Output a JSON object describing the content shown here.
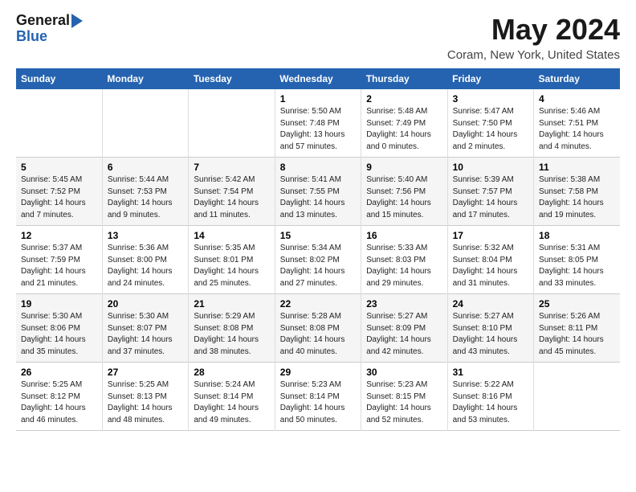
{
  "header": {
    "logo_general": "General",
    "logo_blue": "Blue",
    "title": "May 2024",
    "subtitle": "Coram, New York, United States"
  },
  "weekdays": [
    "Sunday",
    "Monday",
    "Tuesday",
    "Wednesday",
    "Thursday",
    "Friday",
    "Saturday"
  ],
  "weeks": [
    [
      {
        "day": "",
        "info": ""
      },
      {
        "day": "",
        "info": ""
      },
      {
        "day": "",
        "info": ""
      },
      {
        "day": "1",
        "info": "Sunrise: 5:50 AM\nSunset: 7:48 PM\nDaylight: 13 hours\nand 57 minutes."
      },
      {
        "day": "2",
        "info": "Sunrise: 5:48 AM\nSunset: 7:49 PM\nDaylight: 14 hours\nand 0 minutes."
      },
      {
        "day": "3",
        "info": "Sunrise: 5:47 AM\nSunset: 7:50 PM\nDaylight: 14 hours\nand 2 minutes."
      },
      {
        "day": "4",
        "info": "Sunrise: 5:46 AM\nSunset: 7:51 PM\nDaylight: 14 hours\nand 4 minutes."
      }
    ],
    [
      {
        "day": "5",
        "info": "Sunrise: 5:45 AM\nSunset: 7:52 PM\nDaylight: 14 hours\nand 7 minutes."
      },
      {
        "day": "6",
        "info": "Sunrise: 5:44 AM\nSunset: 7:53 PM\nDaylight: 14 hours\nand 9 minutes."
      },
      {
        "day": "7",
        "info": "Sunrise: 5:42 AM\nSunset: 7:54 PM\nDaylight: 14 hours\nand 11 minutes."
      },
      {
        "day": "8",
        "info": "Sunrise: 5:41 AM\nSunset: 7:55 PM\nDaylight: 14 hours\nand 13 minutes."
      },
      {
        "day": "9",
        "info": "Sunrise: 5:40 AM\nSunset: 7:56 PM\nDaylight: 14 hours\nand 15 minutes."
      },
      {
        "day": "10",
        "info": "Sunrise: 5:39 AM\nSunset: 7:57 PM\nDaylight: 14 hours\nand 17 minutes."
      },
      {
        "day": "11",
        "info": "Sunrise: 5:38 AM\nSunset: 7:58 PM\nDaylight: 14 hours\nand 19 minutes."
      }
    ],
    [
      {
        "day": "12",
        "info": "Sunrise: 5:37 AM\nSunset: 7:59 PM\nDaylight: 14 hours\nand 21 minutes."
      },
      {
        "day": "13",
        "info": "Sunrise: 5:36 AM\nSunset: 8:00 PM\nDaylight: 14 hours\nand 24 minutes."
      },
      {
        "day": "14",
        "info": "Sunrise: 5:35 AM\nSunset: 8:01 PM\nDaylight: 14 hours\nand 25 minutes."
      },
      {
        "day": "15",
        "info": "Sunrise: 5:34 AM\nSunset: 8:02 PM\nDaylight: 14 hours\nand 27 minutes."
      },
      {
        "day": "16",
        "info": "Sunrise: 5:33 AM\nSunset: 8:03 PM\nDaylight: 14 hours\nand 29 minutes."
      },
      {
        "day": "17",
        "info": "Sunrise: 5:32 AM\nSunset: 8:04 PM\nDaylight: 14 hours\nand 31 minutes."
      },
      {
        "day": "18",
        "info": "Sunrise: 5:31 AM\nSunset: 8:05 PM\nDaylight: 14 hours\nand 33 minutes."
      }
    ],
    [
      {
        "day": "19",
        "info": "Sunrise: 5:30 AM\nSunset: 8:06 PM\nDaylight: 14 hours\nand 35 minutes."
      },
      {
        "day": "20",
        "info": "Sunrise: 5:30 AM\nSunset: 8:07 PM\nDaylight: 14 hours\nand 37 minutes."
      },
      {
        "day": "21",
        "info": "Sunrise: 5:29 AM\nSunset: 8:08 PM\nDaylight: 14 hours\nand 38 minutes."
      },
      {
        "day": "22",
        "info": "Sunrise: 5:28 AM\nSunset: 8:08 PM\nDaylight: 14 hours\nand 40 minutes."
      },
      {
        "day": "23",
        "info": "Sunrise: 5:27 AM\nSunset: 8:09 PM\nDaylight: 14 hours\nand 42 minutes."
      },
      {
        "day": "24",
        "info": "Sunrise: 5:27 AM\nSunset: 8:10 PM\nDaylight: 14 hours\nand 43 minutes."
      },
      {
        "day": "25",
        "info": "Sunrise: 5:26 AM\nSunset: 8:11 PM\nDaylight: 14 hours\nand 45 minutes."
      }
    ],
    [
      {
        "day": "26",
        "info": "Sunrise: 5:25 AM\nSunset: 8:12 PM\nDaylight: 14 hours\nand 46 minutes."
      },
      {
        "day": "27",
        "info": "Sunrise: 5:25 AM\nSunset: 8:13 PM\nDaylight: 14 hours\nand 48 minutes."
      },
      {
        "day": "28",
        "info": "Sunrise: 5:24 AM\nSunset: 8:14 PM\nDaylight: 14 hours\nand 49 minutes."
      },
      {
        "day": "29",
        "info": "Sunrise: 5:23 AM\nSunset: 8:14 PM\nDaylight: 14 hours\nand 50 minutes."
      },
      {
        "day": "30",
        "info": "Sunrise: 5:23 AM\nSunset: 8:15 PM\nDaylight: 14 hours\nand 52 minutes."
      },
      {
        "day": "31",
        "info": "Sunrise: 5:22 AM\nSunset: 8:16 PM\nDaylight: 14 hours\nand 53 minutes."
      },
      {
        "day": "",
        "info": ""
      }
    ]
  ]
}
